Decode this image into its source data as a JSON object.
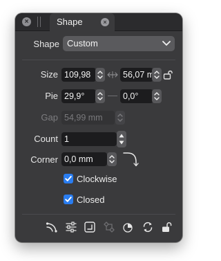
{
  "tab": {
    "title": "Shape"
  },
  "shape": {
    "label": "Shape",
    "selected": "Custom"
  },
  "size": {
    "label": "Size",
    "width": "109,98",
    "height": "56,07 m"
  },
  "pie": {
    "label": "Pie",
    "start": "29,9°",
    "end": "0,0°"
  },
  "gap": {
    "label": "Gap",
    "value": "54,99 mm"
  },
  "count": {
    "label": "Count",
    "value": "1"
  },
  "corner": {
    "label": "Corner",
    "value": "0,0 mm"
  },
  "clockwise": {
    "label": "Clockwise",
    "checked": true
  },
  "closed": {
    "label": "Closed",
    "checked": true
  },
  "colors": {
    "accent": "#2a7df0",
    "panel": "#3a3a3c",
    "field": "#1c1c1e"
  }
}
